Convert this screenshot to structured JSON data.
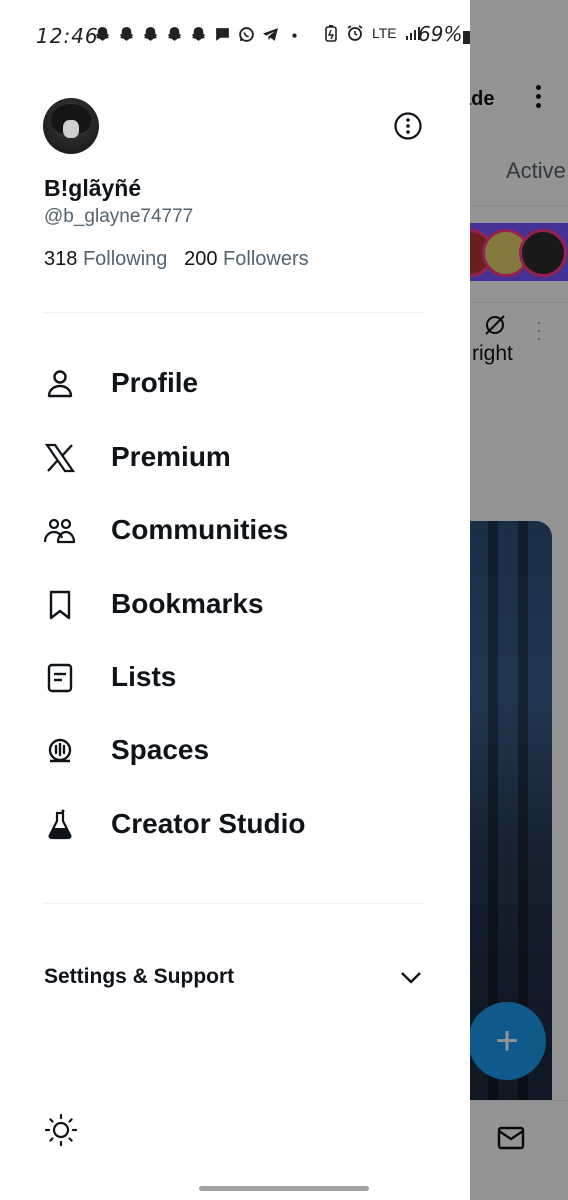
{
  "status_bar": {
    "time": "12:46",
    "network": "LTE",
    "battery": "69%"
  },
  "background": {
    "title": "ade",
    "tab_label": "Active",
    "post_text": "right"
  },
  "profile": {
    "display_name": "B!glãyñé",
    "handle": "@b_glayne74777",
    "following_count": "318",
    "following_label": "Following",
    "followers_count": "200",
    "followers_label": "Followers"
  },
  "menu": {
    "items": [
      {
        "label": "Profile",
        "icon": "person-icon"
      },
      {
        "label": "Premium",
        "icon": "x-logo-icon"
      },
      {
        "label": "Communities",
        "icon": "communities-icon"
      },
      {
        "label": "Bookmarks",
        "icon": "bookmark-icon"
      },
      {
        "label": "Lists",
        "icon": "list-icon"
      },
      {
        "label": "Spaces",
        "icon": "spaces-icon"
      },
      {
        "label": "Creator Studio",
        "icon": "flask-icon"
      }
    ]
  },
  "settings": {
    "label": "Settings & Support"
  },
  "colors": {
    "text_primary": "#0f1419",
    "text_secondary": "#536471",
    "accent": "#1d9bf0"
  }
}
